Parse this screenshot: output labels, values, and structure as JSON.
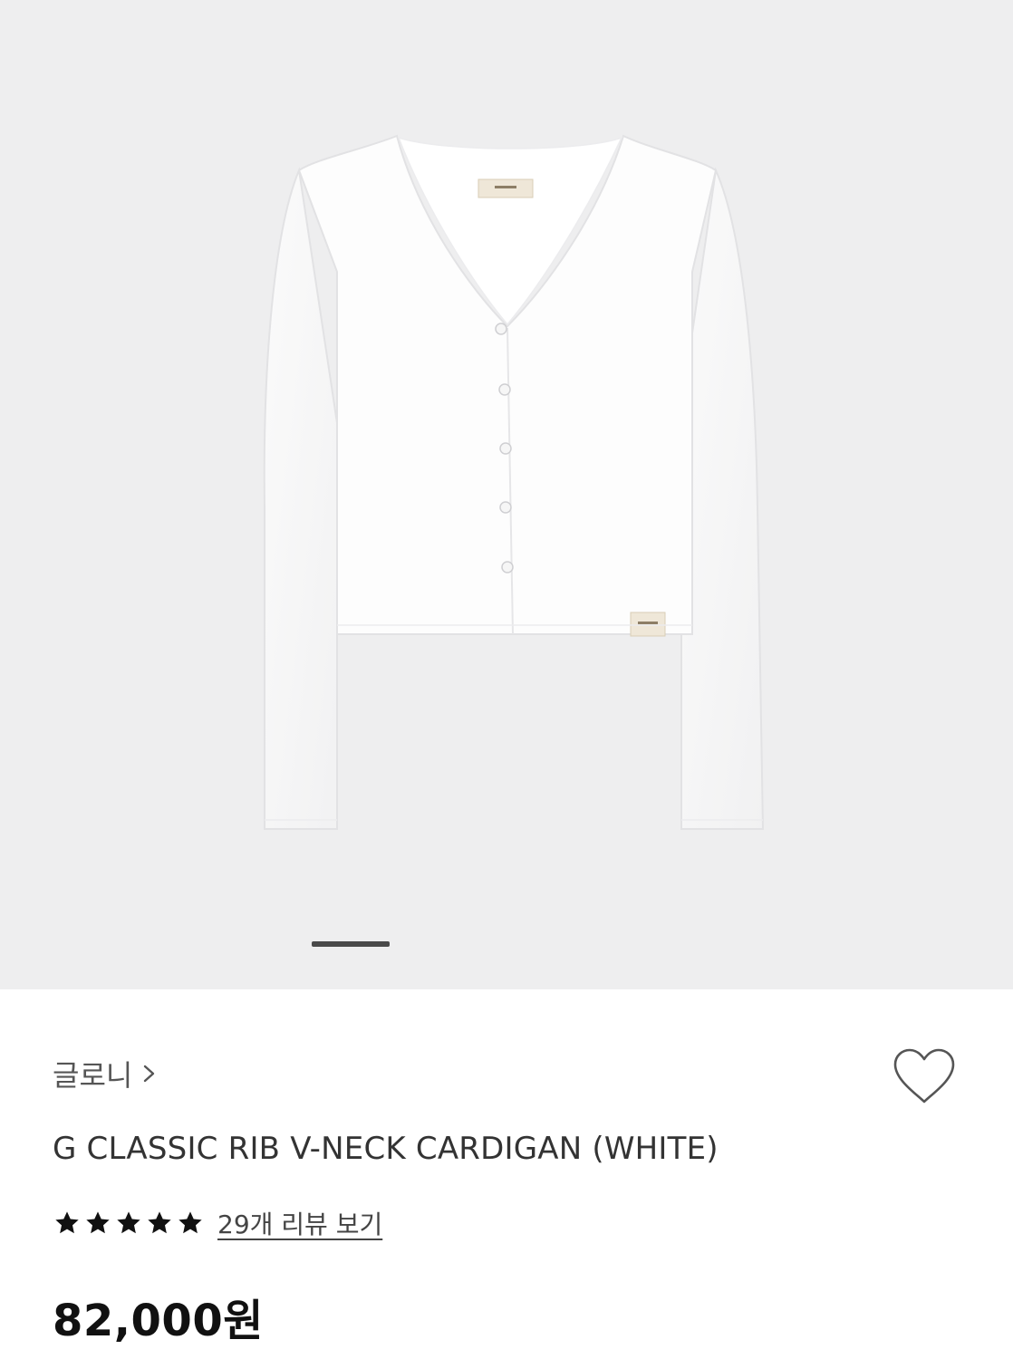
{
  "gallery": {
    "image_description": "white ribbed v-neck cardigan",
    "background_color": "#eeeeef",
    "slide_indicator": {
      "current": 1
    }
  },
  "product": {
    "brand": "글로니",
    "brand_chevron_icon": "chevron-right-icon",
    "wishlist_icon": "heart-outline-icon",
    "name": "G CLASSIC RIB V-NECK CARDIGAN (WHITE)",
    "rating": 5,
    "max_rating": 5,
    "review_link": "29개 리뷰 보기",
    "price": "82,000원"
  }
}
